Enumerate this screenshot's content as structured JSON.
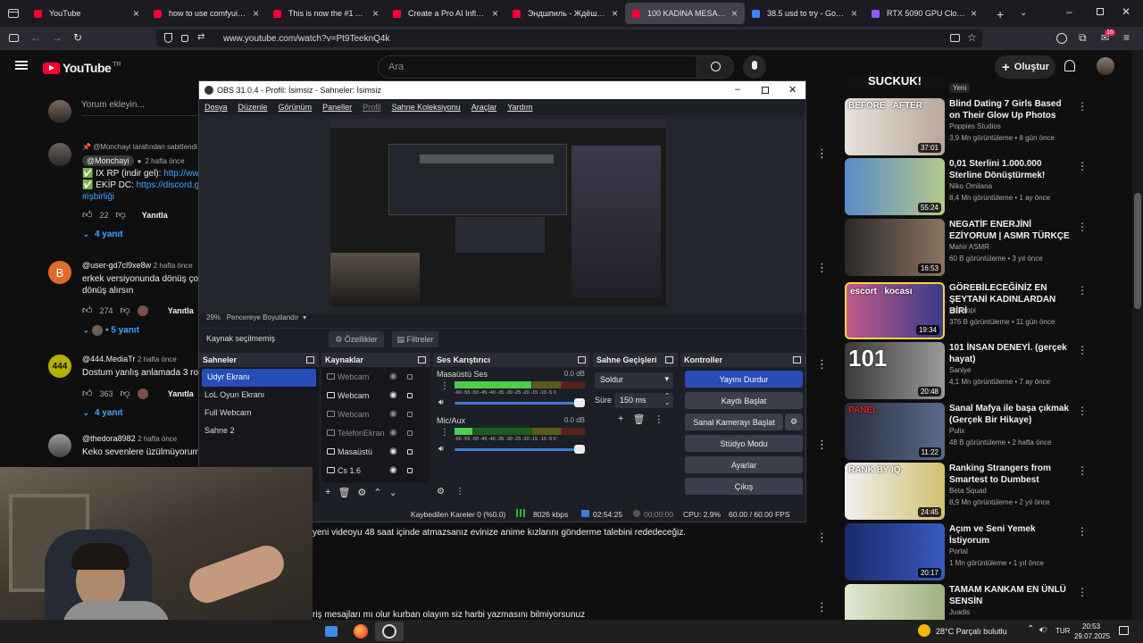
{
  "browser": {
    "tabs": [
      {
        "title": "YouTube",
        "color": "#ff0033"
      },
      {
        "title": "how to use comfyui for ai i",
        "color": "#ff0033"
      },
      {
        "title": "This is now the #1 AI imag",
        "color": "#ff0033"
      },
      {
        "title": "Create a Pro AI Influencer. I",
        "color": "#ff0033"
      },
      {
        "title": "Эндшпиль - Ждёшь (Lyric",
        "color": "#ff0033"
      },
      {
        "title": "100 KADINA MESAJ ATMA",
        "color": "#ff0033",
        "active": true
      },
      {
        "title": "38.5 usd to try - Google'da",
        "color": "#4285f4"
      },
      {
        "title": "RTX 5090 GPU Cloud | $0.9",
        "color": "#8b5cf6"
      }
    ],
    "url": "www.youtube.com/watch?v=Pt9TeeknQ4k",
    "notif_count": "16"
  },
  "youtube": {
    "logo": "YouTube",
    "region": "TR",
    "search_placeholder": "Ara",
    "create_label": "Oluştur",
    "comment_placeholder": "Yorum ekleyin...",
    "comments": [
      {
        "pinned": "@Monchayi tarafından sabitlendi",
        "author": "@Monchayi",
        "time": "2 hafta önce",
        "line1": "✅ IX RP (indir gel): ",
        "link1": "http://www.",
        "line2": "✅ EKİP DC: ",
        "link2": "https://discord.gg/",
        "line3": "#işbirliği",
        "likes": "22",
        "reply": "Yanıtla",
        "replies": "4 yanıt"
      },
      {
        "author": "@user-gd7cl9xe8w",
        "time": "2 hafta önce",
        "text1": "erkek versiyonunda dönüş çok c",
        "text2": "dönüş alırsın",
        "likes": "274",
        "reply": "Yanıtla",
        "replies": "5 yanıt"
      },
      {
        "author": "@444.MediaTr",
        "time": "2 hafta önce",
        "text1": "Dostum yanlış anlamada 3 rolü",
        "likes": "363",
        "reply": "Yanıtla",
        "replies": "4 yanıt"
      },
      {
        "author": "@thedora8982",
        "time": "2 hafta önce",
        "text1": "Keko sevenlere üzülmüyorum la"
      }
    ],
    "visible_comment_text1": "yeni videoyu 48 saat içinde atmazsanız evinize anime kızlarını gönderme talebini rededeceğiz.",
    "visible_comment_text2": "riş mesajları mı olur kurban olayım siz harbi yazmasını bilmiyorsunuz",
    "chip": "Yeni",
    "recommendations": [
      {
        "title": "Blind Dating 7 Girls Based on Their Glow Up Photos",
        "channel": "Poppies Studios",
        "meta": "3,9 Mn görüntüleme • 8 gün önce",
        "duration": "37:01",
        "thumb_text": "BEFORE   AFTER"
      },
      {
        "title": "0,01 Sterlini 1.000.000 Sterline Dönüştürmek!",
        "channel": "Niko Omilana",
        "meta": "8,4 Mn görüntüleme • 1 ay önce",
        "duration": "55:24"
      },
      {
        "title": "NEGATİF ENERJİNİ EZİYORUM | ASMR TÜRKÇE",
        "channel": "Mahir ASMR",
        "meta": "60 B görüntüleme • 3 yıl önce",
        "duration": "16:53"
      },
      {
        "title": "GÖREBİLECEĞİNİZ EN ŞEYTANİ KADINLARDAN BİRİ",
        "channel": "Bentropi",
        "meta": "376 B görüntüleme • 11 gün önce",
        "duration": "19:34",
        "thumb_text": "escort   kocası"
      },
      {
        "title": "101 İNSAN DENEYİ. (gerçek hayat)",
        "channel": "Saniye",
        "meta": "4,1 Mn görüntüleme • 7 ay önce",
        "duration": "20:48",
        "thumb_text": "101"
      },
      {
        "title": "Sanal Mafya ile başa çıkmak (Gerçek Bir Hikaye)",
        "channel": "Pulix",
        "meta": "48 B görüntüleme • 2 hafta önce",
        "duration": "11:22",
        "thumb_text": "PANEL"
      },
      {
        "title": "Ranking Strangers from Smartest to Dumbest",
        "channel": "Beta Squad",
        "meta": "8,9 Mn görüntüleme • 2 yıl önce",
        "duration": "24:45",
        "thumb_text": "RANK BY IQ"
      },
      {
        "title": "Açım ve Seni Yemek İstiyorum",
        "channel": "Portal",
        "meta": "1 Mn görüntüleme • 1 yıl önce",
        "duration": "20:17"
      },
      {
        "title": "TAMAM KANKAM  EN ÜNLÜ SENSİN",
        "channel": "Juadis",
        "meta": "",
        "duration": ""
      }
    ]
  },
  "obs": {
    "title": "OBS 31.0.4 - Profil: İsimsiz - Sahneler: İsimsiz",
    "menu": [
      "Dosya",
      "Düzenle",
      "Görünüm",
      "Paneller",
      "Profil",
      "Sahne Koleksiyonu",
      "Araçlar",
      "Yardım"
    ],
    "zoom": "29%",
    "zoom_mode": "Pencereye Boyutlandır",
    "no_source": "Kaynak seçilmemiş",
    "properties": "Özellikler",
    "filters": "Filtreler",
    "docks": {
      "scenes": "Sahneler",
      "sources": "Kaynaklar",
      "mixer": "Ses Karıştırıcı",
      "transitions": "Sahne Geçişleri",
      "controls": "Kontroller"
    },
    "scenes": [
      "Udyr Ekranı",
      "LoL Oyun Ekranı",
      "Full Webcam",
      "Sahne 2"
    ],
    "sources": [
      {
        "name": "Webcam",
        "dim": true
      },
      {
        "name": "Webcam",
        "dim": false
      },
      {
        "name": "Webcam",
        "dim": true
      },
      {
        "name": "TelefonEkran",
        "dim": true
      },
      {
        "name": "Masaüstü",
        "dim": false
      },
      {
        "name": "Cs 1.6",
        "dim": false
      }
    ],
    "mixer": [
      {
        "name": "Masaüstü Ses",
        "db": "0.0 dB"
      },
      {
        "name": "Mic/Aux",
        "db": "0.0 dB"
      }
    ],
    "meter_scale": "-60 -55 -50 -45 -40 -35 -30 -25 -20 -15 -10 -5 0",
    "transition": "Soldur",
    "duration_label": "Süre",
    "duration_value": "150 ms",
    "controls": [
      "Yayını Durdur",
      "Kaydı Başlat",
      "Sanal Kamerayı Başlat",
      "Stüdyo Modu",
      "Ayarlar",
      "Çıkış"
    ],
    "status": {
      "dropped": "Kaybedilen Kareler 0 (%0.0)",
      "bitrate": "8026 kbps",
      "stream_time": "02:54:25",
      "rec_time": "00:00:00",
      "cpu": "CPU: 2.9%",
      "fps": "60.00 / 60.00 FPS"
    }
  },
  "taskbar": {
    "weather": "28°C  Parçalı bulutlu",
    "lang": "TUR",
    "time": "20:53",
    "date": "29.07.2025"
  }
}
